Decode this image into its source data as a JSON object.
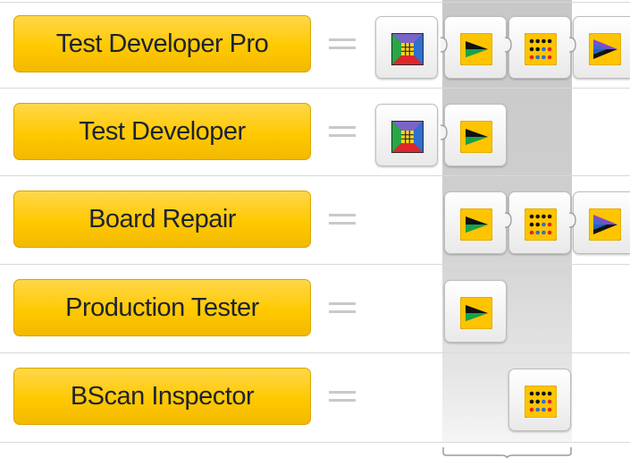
{
  "rows": [
    {
      "label": "Test Developer Pro",
      "equals": "=",
      "modules": [
        "layout-module-icon",
        "play-module-icon",
        "dot-matrix-module-icon",
        "multi-play-module-icon"
      ]
    },
    {
      "label": "Test Developer",
      "equals": "=",
      "modules": [
        "layout-module-icon",
        "play-module-icon"
      ]
    },
    {
      "label": "Board Repair",
      "equals": "=",
      "modules": [
        "play-module-icon",
        "dot-matrix-module-icon",
        "multi-play-module-icon"
      ]
    },
    {
      "label": "Production Tester",
      "equals": "=",
      "modules": [
        "play-module-icon"
      ]
    },
    {
      "label": "BScan Inspector",
      "equals": "=",
      "modules": [
        "dot-matrix-module-icon"
      ]
    }
  ],
  "colors": {
    "button": "#ffc900",
    "button_text": "#1e2230",
    "highlight_column": "#cccccc",
    "separator": "#d9d9d9"
  }
}
